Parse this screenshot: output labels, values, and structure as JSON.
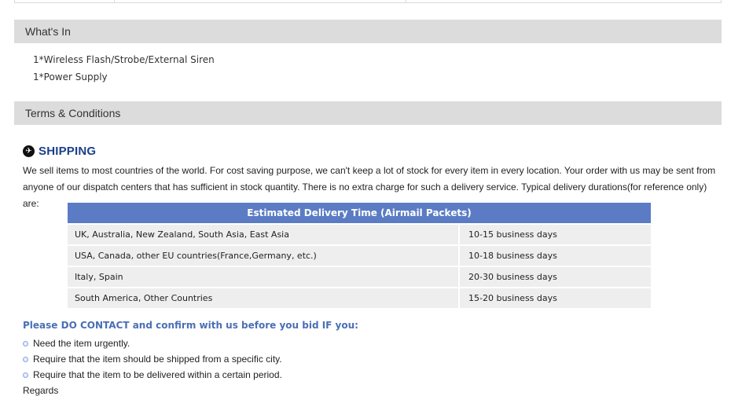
{
  "whats_in": {
    "title": "What's In",
    "items": [
      "1*Wireless Flash/Strobe/External Siren",
      "1*Power Supply"
    ]
  },
  "terms": {
    "title": "Terms & Conditions"
  },
  "shipping": {
    "title": "SHIPPING",
    "text": "We sell items to most countries of the world. For cost saving purpose, we can't keep a lot of stock for every item in every location. Your order with us may be sent from anyone of our dispatch centers that has sufficient in stock quantity. There is no extra charge for such a delivery service. Typical delivery durations(for reference only) are:",
    "table": {
      "header": "Estimated Delivery Time (Airmail Packets)",
      "rows": [
        {
          "region": "UK, Australia, New Zealand, South Asia, East Asia",
          "time": "10-15 business days"
        },
        {
          "region": "USA, Canada, other EU countries(France,Germany, etc.)",
          "time": "10-18 business days"
        },
        {
          "region": "Italy, Spain",
          "time": "20-30 business days"
        },
        {
          "region": "South America, Other Countries",
          "time": "15-20 business days"
        }
      ]
    }
  },
  "contact": {
    "title": "Please DO CONTACT and confirm with us before you bid IF you:",
    "items": [
      "Need the item urgently.",
      "Require that the item should be shipped from a specific city.",
      "Require that the item to be delivered within a certain period."
    ]
  },
  "regards": "Regards"
}
